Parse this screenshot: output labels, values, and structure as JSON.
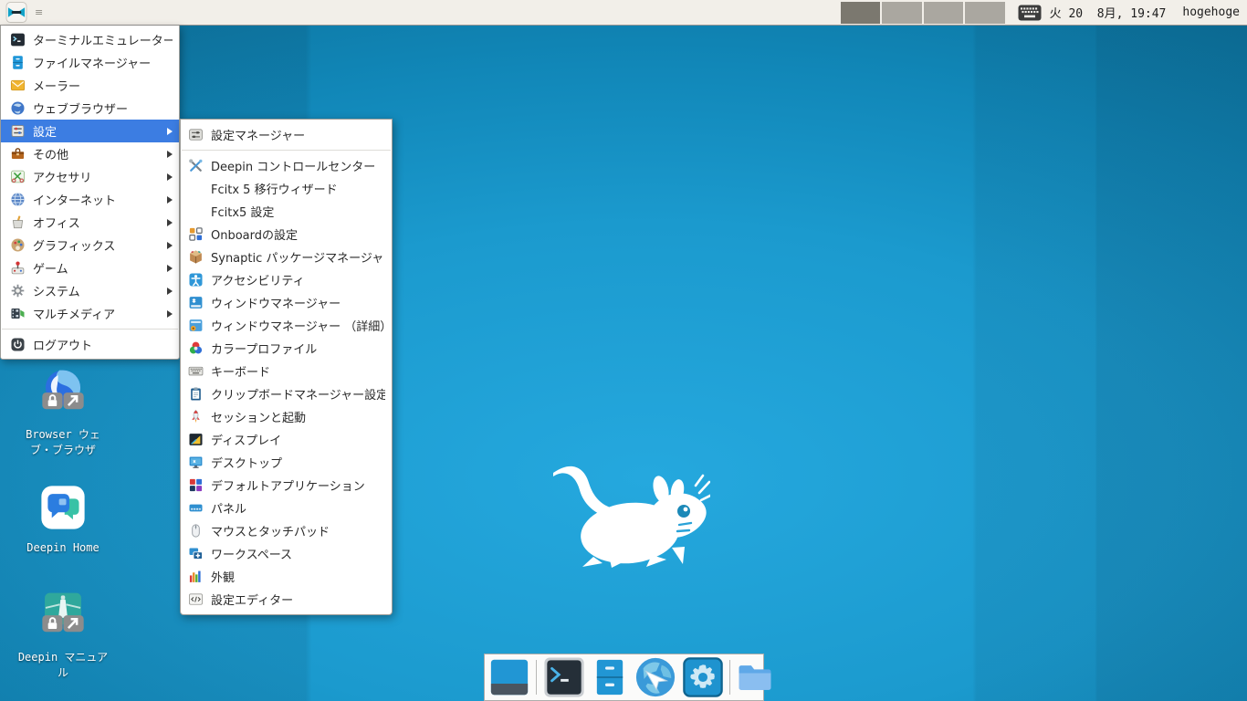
{
  "panel": {
    "menu_button_icon": "xfce-logo-icon",
    "window_list_glyph": "≡",
    "workspaces": {
      "count": 4,
      "active_index": 0
    },
    "keyboard_indicator_icon": "keyboard-layout-icon",
    "clock_text": "火 20  8月, 19:47",
    "username": "hogehoge"
  },
  "app_menu": {
    "items": [
      {
        "label": "ターミナルエミュレーター",
        "icon": "terminal-icon"
      },
      {
        "label": "ファイルマネージャー",
        "icon": "file-manager-icon"
      },
      {
        "label": "メーラー",
        "icon": "mail-icon"
      },
      {
        "label": "ウェブブラウザー",
        "icon": "web-browser-icon"
      },
      {
        "label": "設定",
        "icon": "settings-category-icon",
        "submenu": true,
        "selected": true
      },
      {
        "label": "その他",
        "icon": "other-category-icon",
        "submenu": true
      },
      {
        "label": "アクセサリ",
        "icon": "accessories-icon",
        "submenu": true
      },
      {
        "label": "インターネット",
        "icon": "internet-icon",
        "submenu": true
      },
      {
        "label": "オフィス",
        "icon": "office-icon",
        "submenu": true
      },
      {
        "label": "グラフィックス",
        "icon": "graphics-icon",
        "submenu": true
      },
      {
        "label": "ゲーム",
        "icon": "games-icon",
        "submenu": true
      },
      {
        "label": "システム",
        "icon": "system-icon",
        "submenu": true
      },
      {
        "label": "マルチメディア",
        "icon": "multimedia-icon",
        "submenu": true
      },
      {
        "separator": true
      },
      {
        "label": "ログアウト",
        "icon": "logout-icon"
      }
    ]
  },
  "settings_submenu": {
    "items": [
      {
        "label": "設定マネージャー",
        "icon": "settings-manager-icon",
        "separator_after": true
      },
      {
        "label": "Deepin コントロールセンター",
        "icon": "deepin-control-center-icon"
      },
      {
        "label": "Fcitx 5 移行ウィザード",
        "icon": null
      },
      {
        "label": "Fcitx5 設定",
        "icon": null
      },
      {
        "label": "Onboardの設定",
        "icon": "onboard-icon"
      },
      {
        "label": "Synaptic パッケージマネージャ",
        "icon": "synaptic-icon"
      },
      {
        "label": "アクセシビリティ",
        "icon": "accessibility-icon"
      },
      {
        "label": "ウィンドウマネージャー",
        "icon": "window-manager-icon"
      },
      {
        "label": "ウィンドウマネージャー （詳細）",
        "icon": "window-manager-tweaks-icon"
      },
      {
        "label": "カラープロファイル",
        "icon": "color-profile-icon"
      },
      {
        "label": "キーボード",
        "icon": "keyboard-icon"
      },
      {
        "label": "クリップボードマネージャー設定",
        "icon": "clipboard-icon"
      },
      {
        "label": "セッションと起動",
        "icon": "session-startup-icon"
      },
      {
        "label": "ディスプレイ",
        "icon": "display-icon"
      },
      {
        "label": "デスクトップ",
        "icon": "desktop-settings-icon"
      },
      {
        "label": "デフォルトアプリケーション",
        "icon": "default-applications-icon"
      },
      {
        "label": "パネル",
        "icon": "panel-settings-icon"
      },
      {
        "label": "マウスとタッチパッド",
        "icon": "mouse-touchpad-icon"
      },
      {
        "label": "ワークスペース",
        "icon": "workspaces-icon"
      },
      {
        "label": "外観",
        "icon": "appearance-icon"
      },
      {
        "label": "設定エディター",
        "icon": "settings-editor-icon"
      }
    ]
  },
  "desktop": {
    "icons": [
      {
        "label": "Browser ウェブ・ブラウザ",
        "icon": "browser-desktop-icon"
      },
      {
        "label": "Deepin Home",
        "icon": "deepin-home-icon"
      },
      {
        "label": "Deepin マニュアル",
        "icon": "deepin-manual-icon"
      }
    ],
    "logo": "xfce-mouse-logo"
  },
  "dock": {
    "items": [
      {
        "name": "show-desktop",
        "icon": "show-desktop-icon"
      },
      {
        "separator": true
      },
      {
        "name": "terminal",
        "icon": "terminal-dock-icon"
      },
      {
        "name": "file-manager",
        "icon": "file-cabinet-icon"
      },
      {
        "name": "web-browser",
        "icon": "globe-cursor-icon"
      },
      {
        "name": "settings",
        "icon": "settings-gear-icon"
      },
      {
        "separator": true
      },
      {
        "name": "file-browser",
        "icon": "folder-icon"
      }
    ]
  },
  "colors": {
    "selection_blue": "#3c7de2",
    "panel_background": "#f2efe9",
    "wallpaper_center": "#25a8de",
    "wallpaper_edge": "#095f86",
    "menu_background": "#ffffff"
  }
}
